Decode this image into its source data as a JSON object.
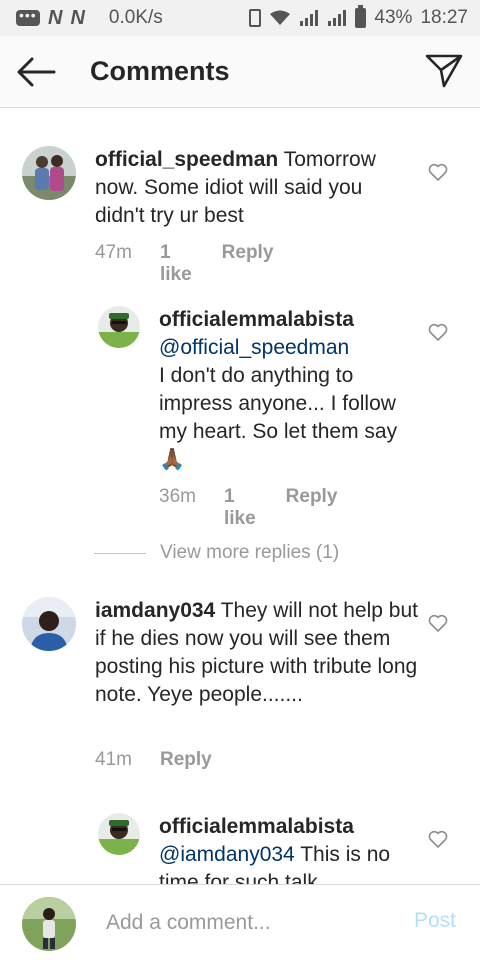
{
  "status_bar": {
    "n1": "N",
    "n2": "N",
    "speed": "0.0K/s",
    "battery": "43%",
    "time": "18:27"
  },
  "header": {
    "title": "Comments"
  },
  "comments": [
    {
      "username": "official_speedman",
      "text": " Tomorrow now. Some idiot will said you didn't try ur best",
      "time": "47m",
      "likes": "1 like",
      "reply": "Reply"
    },
    {
      "username": "officialemmalabista",
      "mention": "@official_speedman",
      "text": "I don't do anything to impress anyone... I follow my heart.  So let them say🙏🏾",
      "time": "36m",
      "likes": "1 like",
      "reply": "Reply"
    },
    {
      "username": "iamdany034",
      "text": " They will not help but if he dies now you will see them posting his picture with tribute long note. Yeye people.......",
      "time": "41m",
      "reply": "Reply"
    },
    {
      "username": "officialemmalabista",
      "mention": "@iamdany034",
      "text": " This is no time for such talk"
    }
  ],
  "view_more": "View more replies (1)",
  "input": {
    "placeholder": "Add a comment...",
    "post_label": "Post"
  },
  "colors": {
    "mention": "#003569",
    "meta_gray": "#999999",
    "post_disabled": "#b2dffc"
  }
}
